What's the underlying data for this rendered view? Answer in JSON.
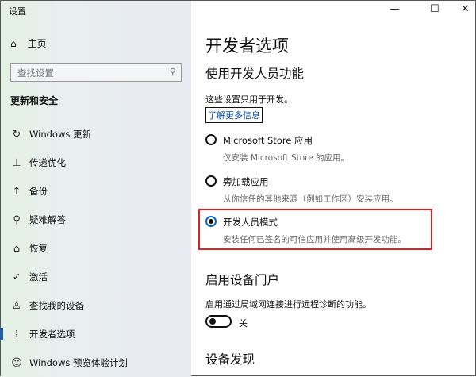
{
  "window": {
    "title": "设置",
    "minimize": "—",
    "maximize": "☐",
    "close": "✕"
  },
  "sidebar": {
    "home": "主页",
    "search_placeholder": "查找设置",
    "section": "更新和安全",
    "items": [
      {
        "label": "Windows 更新",
        "icon": "↻"
      },
      {
        "label": "传递优化",
        "icon": "⊥"
      },
      {
        "label": "备份",
        "icon": "↑"
      },
      {
        "label": "疑难解答",
        "icon": "⚲"
      },
      {
        "label": "恢复",
        "icon": "⌂"
      },
      {
        "label": "激活",
        "icon": "✓"
      },
      {
        "label": "查找我的设备",
        "icon": "♙"
      },
      {
        "label": "开发者选项",
        "icon": "⁞"
      },
      {
        "label": "Windows 预览体验计划",
        "icon": "☺"
      }
    ],
    "active_index": 7
  },
  "main": {
    "title": "开发者选项",
    "section1": "使用开发人员功能",
    "desc": "这些设置只用于开发。",
    "link": "了解更多信息",
    "options": [
      {
        "label": "Microsoft Store 应用",
        "sub": "仅安装 Microsoft Store 的应用。",
        "selected": false
      },
      {
        "label": "旁加载应用",
        "sub": "从你信任的其他来源（例如工作区）安装应用。",
        "selected": false
      },
      {
        "label": "开发人员模式",
        "sub": "安装任何已签名的可信应用并使用高级开发功能。",
        "selected": true
      }
    ],
    "section2": "启用设备门户",
    "portal_desc": "启用通过局域网连接进行远程诊断的功能。",
    "toggle_label": "关",
    "toggle_on": false,
    "section3": "设备发现"
  }
}
